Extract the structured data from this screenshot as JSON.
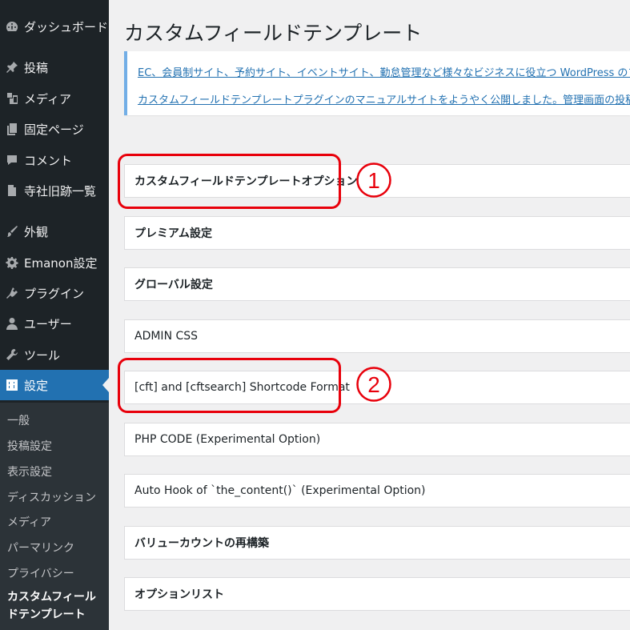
{
  "sidebar": {
    "items": [
      {
        "label": "ダッシュボード",
        "icon": "dashboard-icon"
      },
      {
        "label": "投稿",
        "icon": "pin-icon"
      },
      {
        "label": "メディア",
        "icon": "media-icon"
      },
      {
        "label": "固定ページ",
        "icon": "page-icon"
      },
      {
        "label": "コメント",
        "icon": "comment-icon"
      },
      {
        "label": "寺社旧跡一覧",
        "icon": "document-icon"
      },
      {
        "label": "外観",
        "icon": "brush-icon"
      },
      {
        "label": "Emanon設定",
        "icon": "gear-icon"
      },
      {
        "label": "プラグイン",
        "icon": "plugin-icon"
      },
      {
        "label": "ユーザー",
        "icon": "user-icon"
      },
      {
        "label": "ツール",
        "icon": "wrench-icon"
      },
      {
        "label": "設定",
        "icon": "settings-icon"
      }
    ],
    "submenu": [
      "一般",
      "投稿設定",
      "表示設定",
      "ディスカッション",
      "メディア",
      "パーマリンク",
      "プライバシー",
      "カスタムフィールドテンプレート"
    ]
  },
  "page": {
    "title": "カスタムフィールドテンプレート",
    "notice_links": [
      "EC、会員制サイト、予約サイト、イベントサイト、勤怠管理など様々なビジネスに役立つ WordPress のプラグインをまとめ",
      "カスタムフィールドテンプレートプラグインのマニュアルサイトをようやく公開しました。管理画面の投稿リストでカスタム"
    ]
  },
  "panels": [
    "カスタムフィールドテンプレートオプション",
    "プレミアム設定",
    "グローバル設定",
    "ADMIN CSS",
    "[cft] and [cftsearch] Shortcode Format",
    "PHP CODE (Experimental Option)",
    "Auto Hook of `the_content()` (Experimental Option)",
    "バリューカウントの再構築",
    "オプションリスト"
  ],
  "annotations": {
    "marker_1": "1",
    "marker_2": "2",
    "color": "#e8000b"
  },
  "colors": {
    "sidebar_bg": "#1d2327",
    "submenu_bg": "#2c3338",
    "accent": "#2271b1",
    "notice_border": "#72aee6"
  }
}
